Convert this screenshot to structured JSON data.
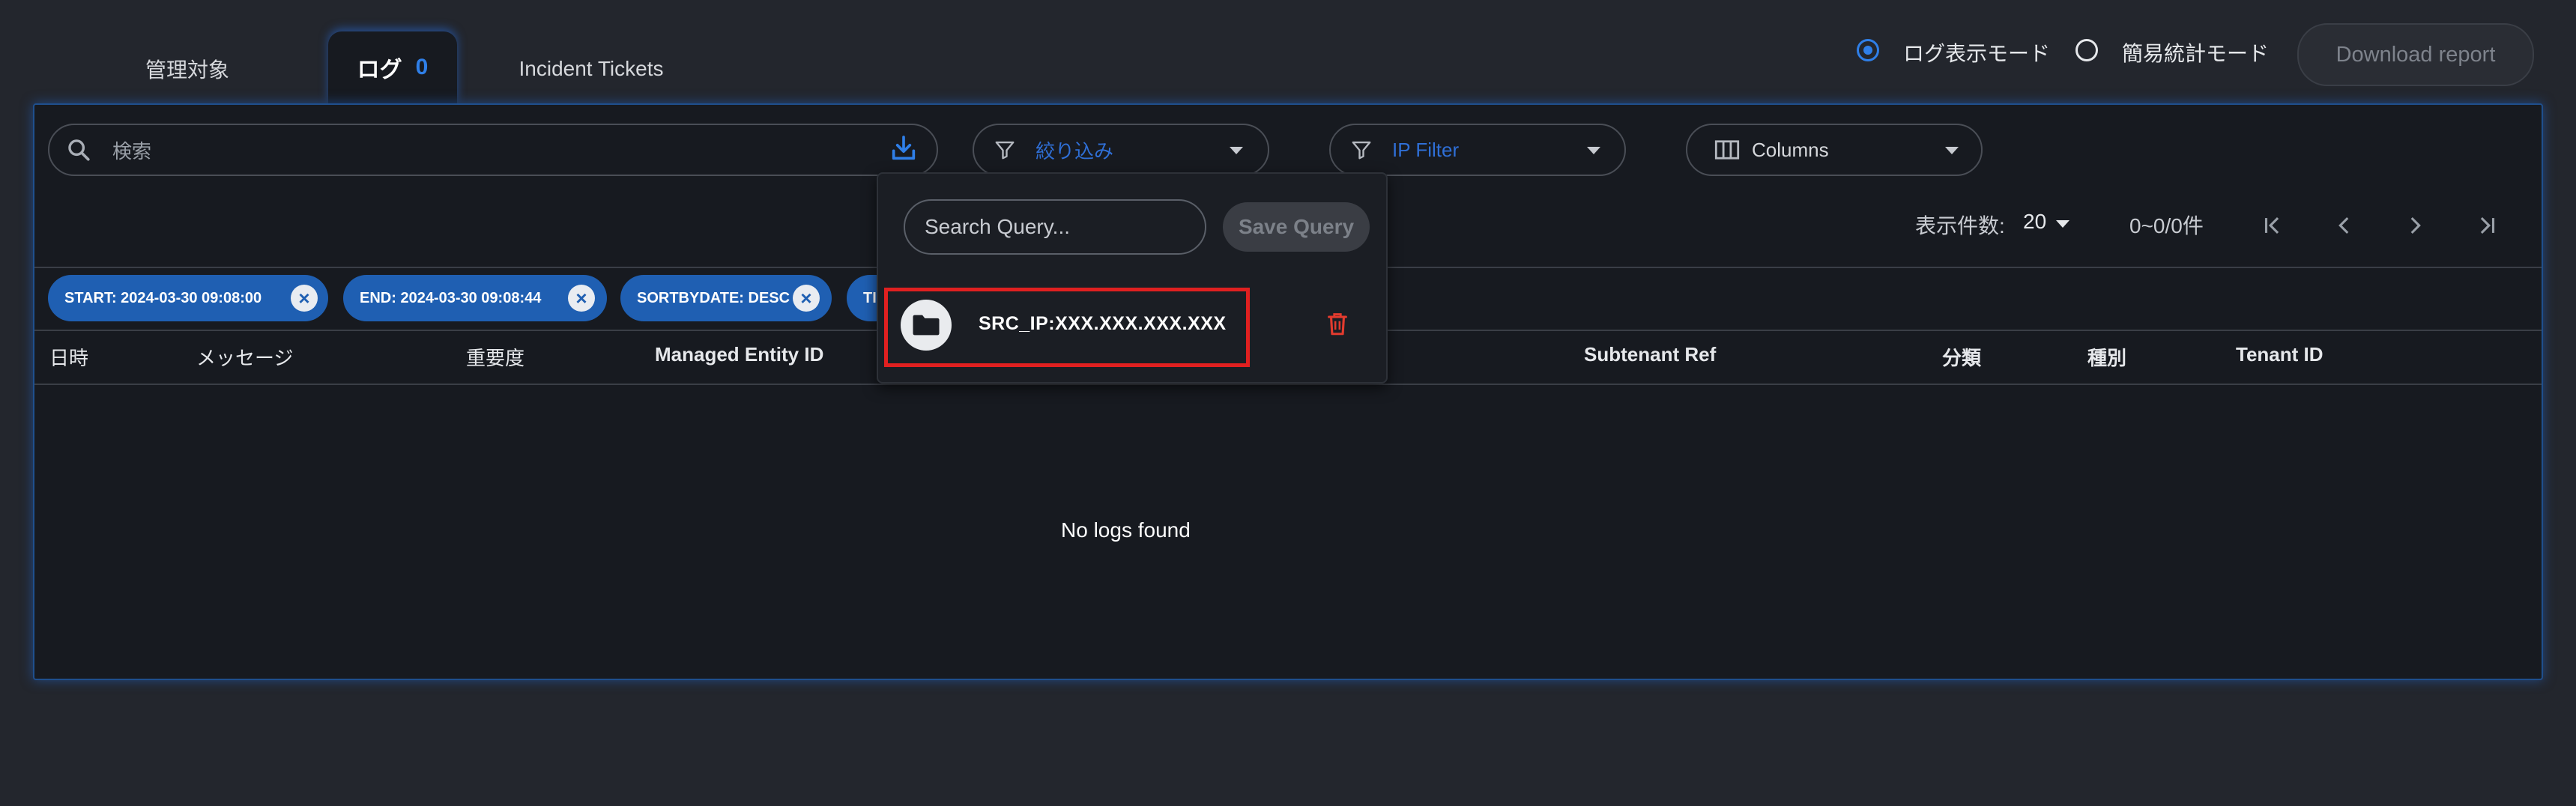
{
  "tabs": [
    {
      "label": "管理対象"
    },
    {
      "label": "ログ",
      "count": "0"
    },
    {
      "label": "Incident Tickets"
    }
  ],
  "modes": {
    "log_mode": "ログ表示モード",
    "stats_mode": "簡易統計モード",
    "selected": "log_mode"
  },
  "download_label": "Download report",
  "toolbar": {
    "search_placeholder": "検索",
    "filter_label": "絞り込み",
    "ip_filter_label": "IP Filter",
    "columns_label": "Columns"
  },
  "pagination": {
    "rows_label": "表示件数:",
    "rows_value": "20",
    "range": "0~0/0件"
  },
  "chips": [
    {
      "label": "START: 2024-03-30 09:08:00"
    },
    {
      "label": "END: 2024-03-30 09:08:44"
    },
    {
      "label": "SORTBYDATE: DESC"
    },
    {
      "label": "TI"
    }
  ],
  "columns": [
    "日時",
    "メッセージ",
    "重要度",
    "Managed Entity ID",
    "Subtenant Ref",
    "分類",
    "種別",
    "Tenant ID"
  ],
  "empty_message": "No logs found",
  "saved_query_dropdown": {
    "search_placeholder": "Search Query...",
    "save_label": "Save Query",
    "queries": [
      {
        "text": "SRC_IP:XXX.XXX.XXX.XXX"
      }
    ]
  },
  "colors": {
    "accent": "#2f7fe8",
    "chip": "#1f5fb2",
    "highlight": "#e02020",
    "delete": "#e23b2e"
  }
}
